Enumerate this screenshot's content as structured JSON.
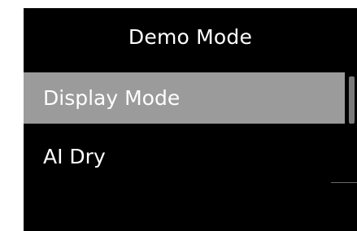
{
  "menu": {
    "title": "Demo Mode",
    "items": [
      {
        "label": "Display Mode",
        "selected": true
      },
      {
        "label": "AI Dry",
        "selected": false
      }
    ]
  },
  "colors": {
    "background": "#000000",
    "selected_background": "#9b9b9b",
    "text": "#ffffff"
  }
}
